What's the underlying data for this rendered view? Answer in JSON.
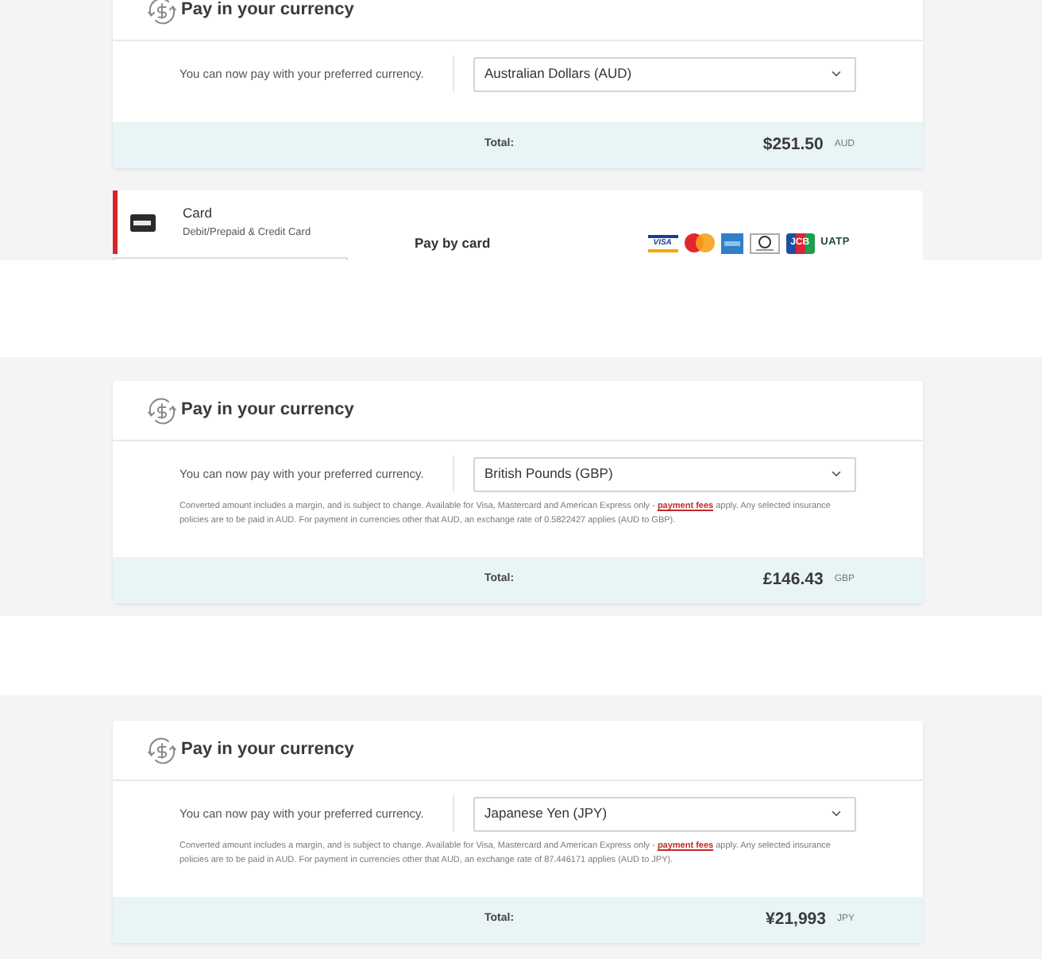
{
  "views": [
    {
      "currency_panel": {
        "title": "Pay in your currency",
        "prompt": "You can now pay with your preferred currency.",
        "currency_select": {
          "value": "Australian Dollars (AUD)"
        },
        "total": {
          "label": "Total:",
          "amount": "$251.50",
          "currency": "AUD"
        }
      },
      "payment_panel": {
        "methods": [
          {
            "title": "Card",
            "subtitle": "Debit/Prepaid & Credit Card",
            "selected": true
          }
        ],
        "heading": "Pay by card",
        "card_brands": [
          {
            "kind": "visa",
            "label": "VISA"
          },
          {
            "kind": "mastercard"
          },
          {
            "kind": "amex"
          },
          {
            "kind": "diners"
          },
          {
            "kind": "jcb",
            "label": "JCB"
          },
          {
            "kind": "uatp",
            "label": "UATP"
          }
        ]
      }
    },
    {
      "currency_panel": {
        "title": "Pay in your currency",
        "prompt": "You can now pay with your preferred currency.",
        "currency_select": {
          "value": "British Pounds (GBP)"
        },
        "notice": {
          "text_before": "Converted amount includes a margin, and is subject to change. Available for Visa, Mastercard and American Express only -",
          "link": "payment fees",
          "text_after": "apply. Any selected insurance policies are to be paid in AUD. For payment in currencies other that AUD, an exchange rate of 0.5822427 applies (AUD to GBP)."
        },
        "total": {
          "label": "Total:",
          "amount": "£146.43",
          "currency": "GBP"
        }
      }
    },
    {
      "currency_panel": {
        "title": "Pay in your currency",
        "prompt": "You can now pay with your preferred currency.",
        "currency_select": {
          "value": "Japanese Yen (JPY)"
        },
        "notice": {
          "text_before": "Converted amount includes a margin, and is subject to change. Available for Visa, Mastercard and American Express only -",
          "link": "payment fees",
          "text_after": "apply. Any selected insurance policies are to be paid in AUD. For payment in currencies other that AUD, an exchange rate of 87.446171 applies (AUD to JPY)."
        },
        "total": {
          "label": "Total:",
          "amount": "¥21,993",
          "currency": "JPY"
        }
      }
    }
  ]
}
